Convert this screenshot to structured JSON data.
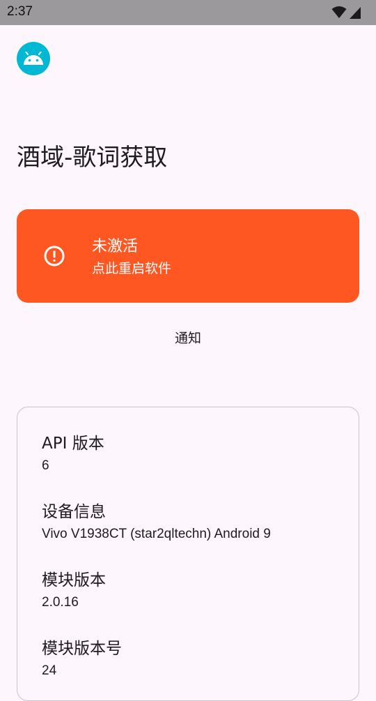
{
  "status_bar": {
    "time": "2:37",
    "icons": [
      "wifi-icon",
      "signal-icon"
    ]
  },
  "app": {
    "icon": "android-icon",
    "icon_color": "#00b7d4",
    "title": "酒域-歌词获取"
  },
  "status_card": {
    "icon": "alert-circle-icon",
    "background": "#ff5722",
    "title": "未激活",
    "subtitle": "点此重启软件"
  },
  "notify_label": "通知",
  "info": {
    "items": [
      {
        "label": "API 版本",
        "value": "6"
      },
      {
        "label": "设备信息",
        "value": "Vivo V1938CT (star2qltechn) Android 9"
      },
      {
        "label": "模块版本",
        "value": "2.0.16"
      },
      {
        "label": "模块版本号",
        "value": "24"
      }
    ]
  }
}
